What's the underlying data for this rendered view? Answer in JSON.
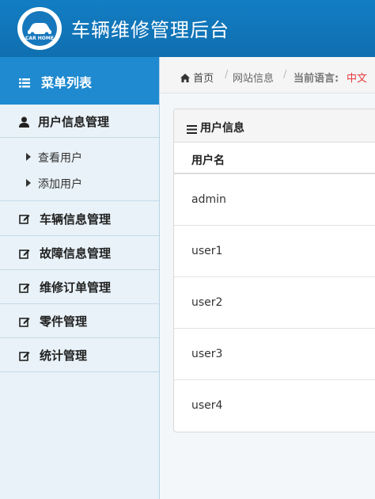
{
  "header": {
    "logo_text": "CAR HOME",
    "title": "车辆维修管理后台"
  },
  "sidebar": {
    "menu_title": "菜单列表",
    "sections": [
      {
        "label": "用户信息管理",
        "icon": "user-icon",
        "expanded": true,
        "children": [
          "查看用户",
          "添加用户"
        ]
      },
      {
        "label": "车辆信息管理",
        "icon": "edit-icon"
      },
      {
        "label": "故障信息管理",
        "icon": "edit-icon"
      },
      {
        "label": "维修订单管理",
        "icon": "edit-icon"
      },
      {
        "label": "零件管理",
        "icon": "edit-icon"
      },
      {
        "label": "统计管理",
        "icon": "edit-icon"
      }
    ]
  },
  "breadcrumb": {
    "home": "首页",
    "site_info": "网站信息",
    "language_label": "当前语言:",
    "language_value": "中文",
    "language_color": "#e4393c"
  },
  "panel": {
    "title": "用户信息",
    "column": "用户名",
    "rows": [
      "admin",
      "user1",
      "user2",
      "user3",
      "user4"
    ]
  },
  "colors": {
    "header": "#137dc3",
    "menu_head": "#1f8ad0",
    "sidebar_bg": "#e9f2f8"
  }
}
